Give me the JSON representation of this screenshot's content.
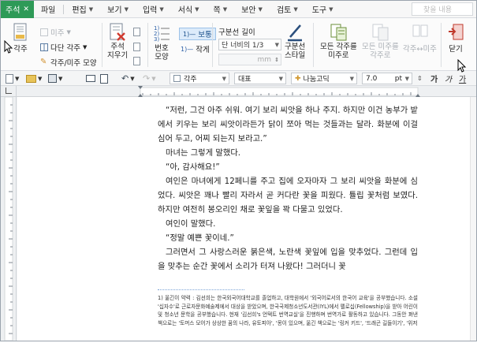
{
  "menubar": {
    "active_tab": "주석",
    "items": [
      "파일",
      "편집",
      "보기",
      "입력",
      "서식",
      "쪽",
      "보안",
      "검토",
      "도구"
    ],
    "search_placeholder": "찾을 내용"
  },
  "ribbon": {
    "note_group": {
      "note": "각주",
      "endnote": "미주",
      "multi_note": "다단 각주",
      "note_shape": "각주/미주 모양"
    },
    "comment": {
      "label": "주석\n지우기"
    },
    "numbering": {
      "number": "번호\n모양"
    },
    "normal": {
      "active": "보통",
      "small": "작게"
    },
    "separator": {
      "title": "구분선 길이",
      "select": "단 너비의 1/3",
      "mm_label": "mm",
      "style": "구분선\n스타일"
    },
    "convert": {
      "all_to_end": "모든 각주를\n미주로",
      "all_to_foot": "모든 미주를\n각주로",
      "foot_end": "각주↔미주"
    },
    "close": "닫기"
  },
  "fmtbar": {
    "style": "각주",
    "lang": "대표",
    "font": "나눔고딕",
    "size": "7.0",
    "unit": "pt",
    "bold": "가",
    "italic": "가",
    "underline": "가"
  },
  "document": {
    "paragraphs": [
      "“저런, 그건 아주 쉬워. 여기 보리 씨앗을 하나 주지. 하지만 이건 농부가 밭에서 키우는 보리 씨앗이라든가 닭이 쪼아 먹는 것들과는 달라. 화분에 이걸 심어 두고, 어찌 되는지 보라고.”",
      "마녀는 그렇게 말했다.",
      "“아, 감사해요!”",
      "여인은 마녀에게 12페니를 주고 집에 오자마자 그 보리 씨앗을 화분에 심었다. 씨앗은 꽤나 빨리 자라서 곧 커다란 꽃을 피웠다. 튤립 꽃처럼 보였다. 하지만 여전히 봉오리인 채로 꽃잎을 꽉 다물고 있었다.",
      "여인이 말했다.",
      "“정말 예쁜 꽃이네.”",
      "그러면서 그 사랑스러운 붉은색, 노란색 꽃잎에 입을 맞추었다. 그런데 입을 맞추는 순간 꽃에서 소리가 터져 나왔다! 그러더니 꽃"
    ],
    "footnote": "1) 옮긴이 약력 : 김선희는 한국외국어대학교를 졸업하고, 대학원에서 '외국어로서의 한국어 교육'을 공부했습니다. 소설 '십자수'로 근로자문화예술제에서 대상을 받았으며, 한국국제청소년도서관(IYL)에서 펠로십(Fellowship)을 받아 어린이 및 청소년 문학을 공부했습니다. 현재 '김선희's 언택트 번역교실'을 진행하며 번역가로 활동하고 있습니다. 그동안 펴낸 책으로는 '토머스 모어가 상상한 꿈의 나라, 유토피아', '몽이 있으며, 옮긴 책으로는 '링커 키드', '드래곤 길들이기', '위저"
  },
  "colors": {
    "active_tab": "#2e9a57",
    "accent_blue": "#1a4f8a",
    "close_red": "#c0392b"
  }
}
